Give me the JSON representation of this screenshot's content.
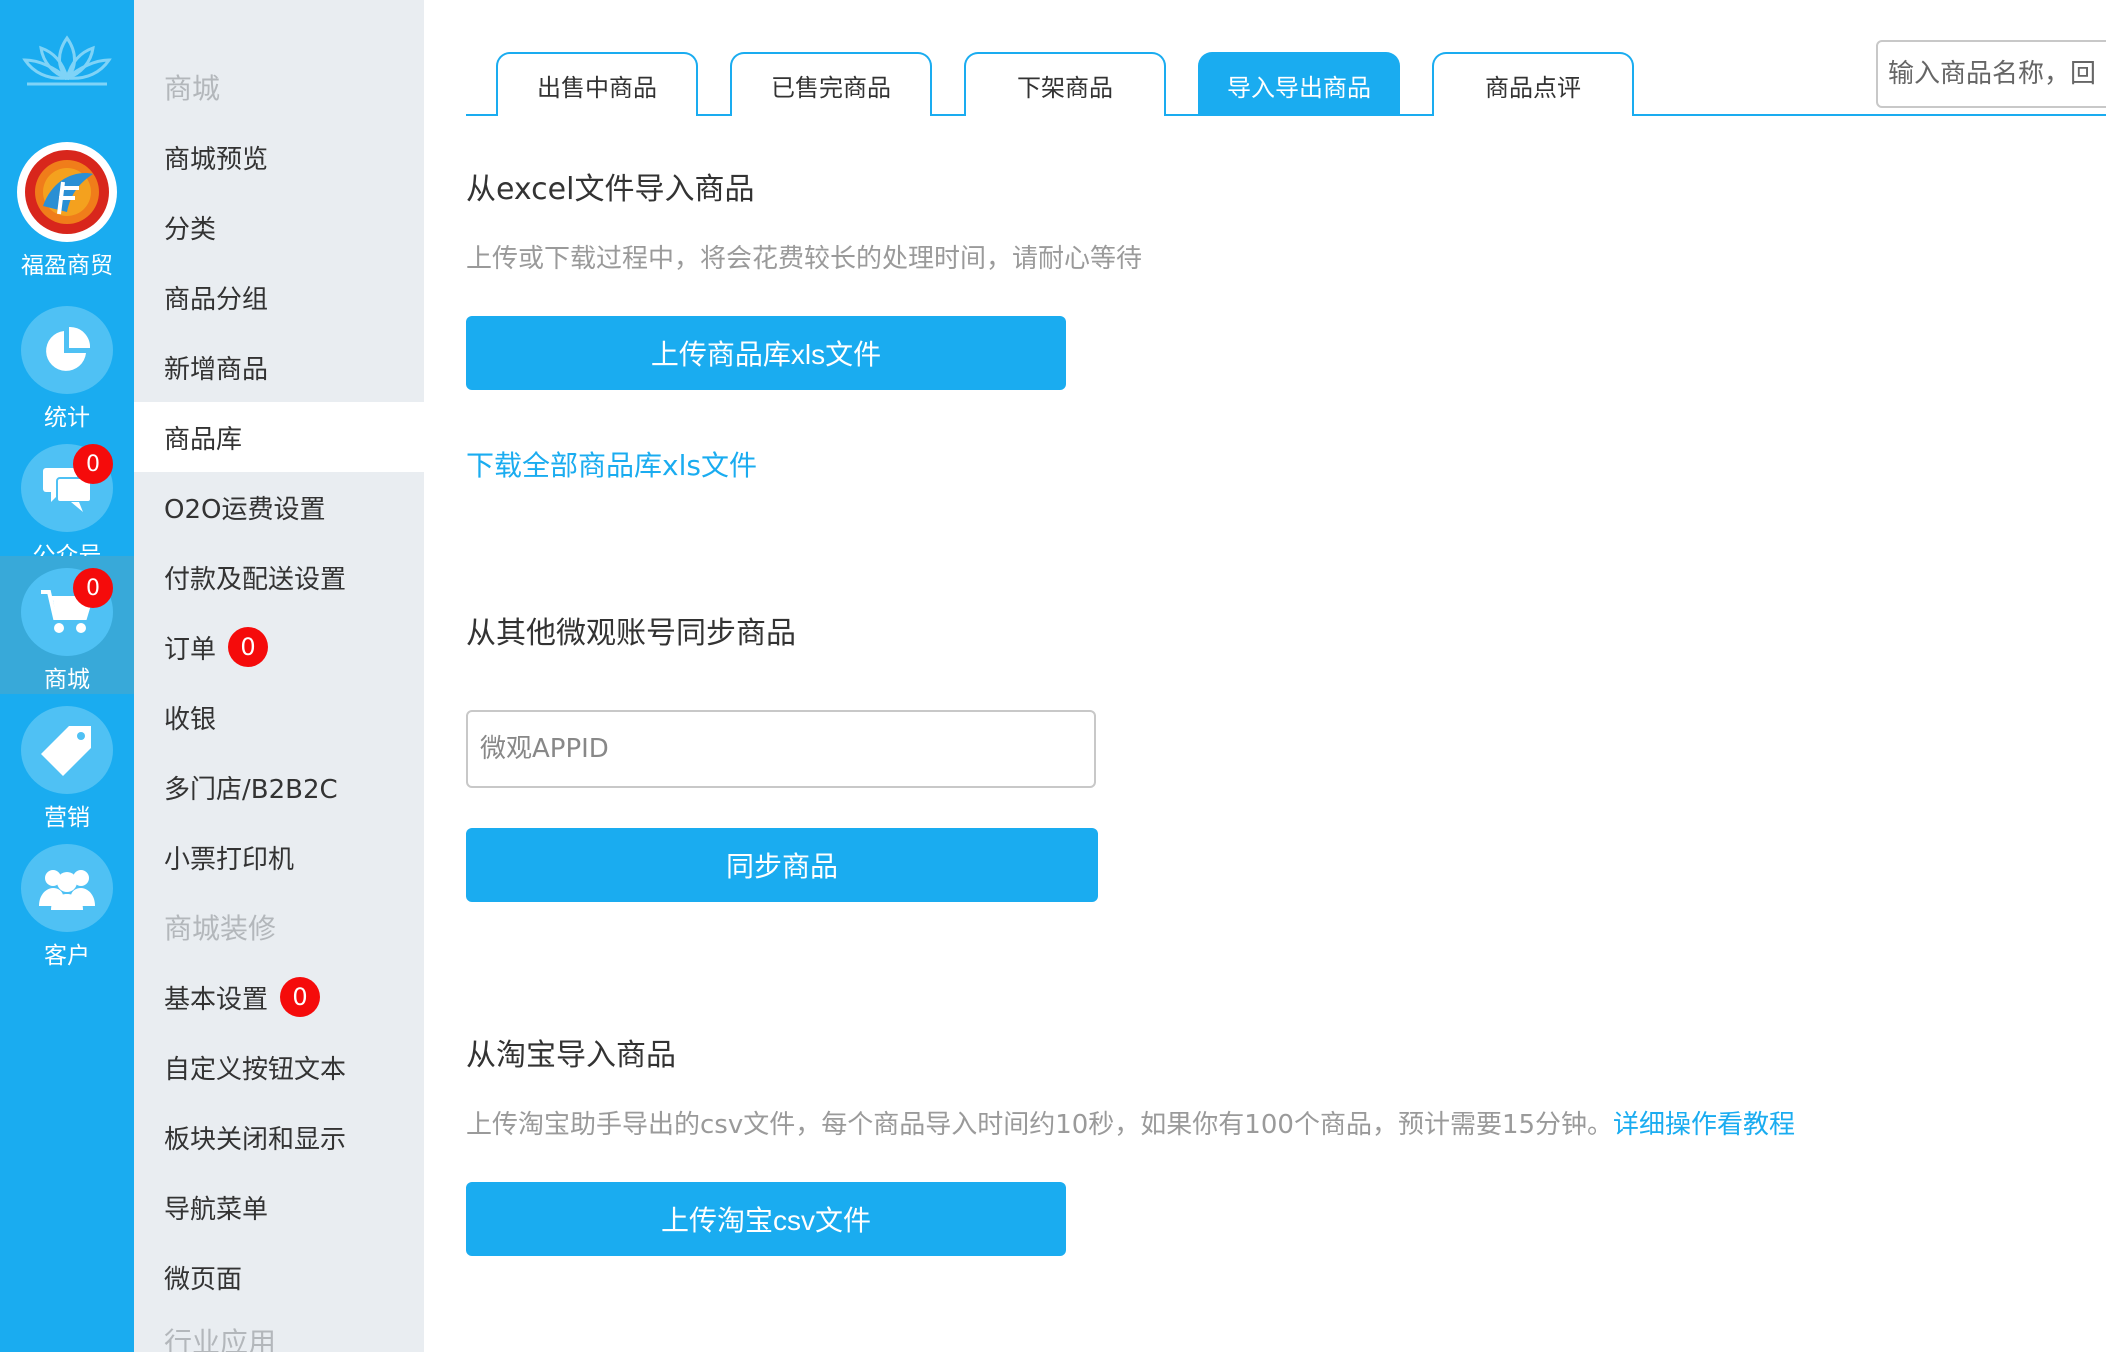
{
  "rail": {
    "brand_name": "福盈商贸",
    "items": [
      {
        "label": "统计",
        "icon": "chart-pie-icon"
      },
      {
        "label": "公众号",
        "icon": "chat-bubbles-icon",
        "badge": "0"
      },
      {
        "label": "商城",
        "icon": "shopping-cart-icon",
        "badge": "0"
      },
      {
        "label": "营销",
        "icon": "tag-icon"
      },
      {
        "label": "客户",
        "icon": "users-icon"
      }
    ]
  },
  "sidebar": {
    "items": [
      {
        "label": "商城",
        "type": "header"
      },
      {
        "label": "商城预览"
      },
      {
        "label": "分类"
      },
      {
        "label": "商品分组"
      },
      {
        "label": "新增商品"
      },
      {
        "label": "商品库",
        "active": true
      },
      {
        "label": "O2O运费设置"
      },
      {
        "label": "付款及配送设置"
      },
      {
        "label": "订单",
        "badge": "0"
      },
      {
        "label": "收银"
      },
      {
        "label": "多门店/B2B2C"
      },
      {
        "label": "小票打印机"
      },
      {
        "label": "商城装修",
        "type": "header"
      },
      {
        "label": "基本设置",
        "badge": "0"
      },
      {
        "label": "自定义按钮文本"
      },
      {
        "label": "板块关闭和显示"
      },
      {
        "label": "导航菜单"
      },
      {
        "label": "微页面"
      },
      {
        "label": "行业应用",
        "type": "header"
      }
    ]
  },
  "tabs": [
    {
      "label": "出售中商品"
    },
    {
      "label": "已售完商品"
    },
    {
      "label": "下架商品"
    },
    {
      "label": "导入导出商品",
      "active": true
    },
    {
      "label": "商品点评"
    }
  ],
  "search": {
    "placeholder": "输入商品名称，回"
  },
  "excel_section": {
    "title": "从excel文件导入商品",
    "hint": "上传或下载过程中，将会花费较长的处理时间，请耐心等待",
    "upload_button": "上传商品库xls文件",
    "download_link": "下载全部商品库xls文件"
  },
  "sync_section": {
    "title": "从其他微观账号同步商品",
    "input_placeholder": "微观APPID",
    "sync_button": "同步商品"
  },
  "taobao_section": {
    "title": "从淘宝导入商品",
    "hint": "上传淘宝助手导出的csv文件，每个商品导入时间约10秒，如果你有100个商品，预计需要15分钟。",
    "tutorial_link": "详细操作看教程",
    "upload_button": "上传淘宝csv文件"
  },
  "colors": {
    "accent": "#1aacf0",
    "badge": "#f50b0b",
    "sidebar_bg": "#e9edf1"
  }
}
